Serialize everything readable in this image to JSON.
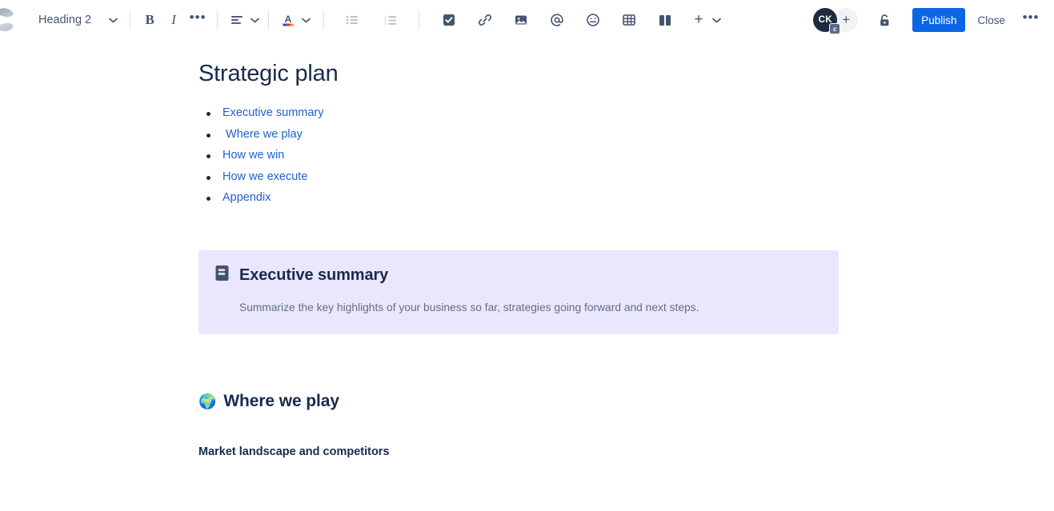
{
  "app": {
    "logo_icon": "confluence-logo-icon"
  },
  "toolbar": {
    "text_style": {
      "label": "Heading 2",
      "chevron_icon": "chevron-down-icon"
    },
    "bold_label": "B",
    "italic_label": "I",
    "more_formatting_label": "•••",
    "alignment_icon": "text-align-left-icon",
    "text_color_icon": "text-color-icon",
    "bullet_list_icon": "bullet-list-icon",
    "numbered_list_icon": "numbered-list-icon",
    "task_icon": "task-checkbox-icon",
    "link_icon": "link-icon",
    "image_icon": "image-icon",
    "mention_icon": "mention-at-icon",
    "emoji_icon": "emoji-icon",
    "table_icon": "table-icon",
    "layout_icon": "layout-columns-icon",
    "insert_label": "+",
    "insert_chevron_icon": "chevron-down-icon",
    "lock_icon": "unlocked-padlock-icon",
    "publish_label": "Publish",
    "close_label": "Close",
    "more_label": "•••",
    "avatar": {
      "initials": "CK",
      "badge": "c"
    },
    "add_person_label": "+"
  },
  "colors": {
    "accent_blue": "#0C66E4",
    "link_blue": "#2262CC",
    "text_navy": "#172B4D",
    "panel_purple": "#EAE6FD",
    "muted_text": "#626F86"
  },
  "document": {
    "title": "Strategic plan",
    "toc": [
      {
        "label": "Executive summary"
      },
      {
        "label": " Where we play"
      },
      {
        "label": "How we win"
      },
      {
        "label": "How we execute"
      },
      {
        "label": "Appendix"
      }
    ],
    "panel": {
      "icon": "notebook-icon",
      "title": "Executive summary",
      "body": "Summarize the key highlights of your business so far, strategies going forward and next steps."
    },
    "section": {
      "emoji": "🌍",
      "title": "Where we play"
    },
    "subheading": "Market landscape and competitors"
  }
}
